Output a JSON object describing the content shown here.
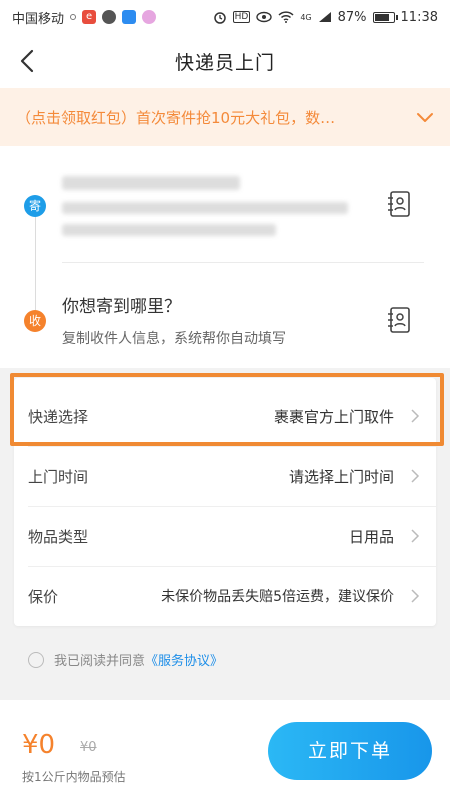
{
  "status_bar": {
    "carrier": "中国移动",
    "battery_percent": "87%",
    "time": "11:38",
    "hd_badge": "HD",
    "network": "4G",
    "battery_level": 0.87
  },
  "nav": {
    "title": "快递员上门"
  },
  "promo": {
    "text": "（点击领取红包）首次寄件抢10元大礼包，数…"
  },
  "address": {
    "sender_tag": "寄",
    "receiver_tag": "收",
    "receiver_title": "你想寄到哪里？",
    "receiver_hint": "复制收件人信息，系统帮你自动填写"
  },
  "options": [
    {
      "label": "快递选择",
      "value": "裹裹官方上门取件"
    },
    {
      "label": "上门时间",
      "value": "请选择上门时间"
    },
    {
      "label": "物品类型",
      "value": "日用品"
    },
    {
      "label": "保价",
      "value": "未保价物品丢失赔5倍运费，建议保价"
    }
  ],
  "agreement": {
    "prefix": "我已阅读并同意",
    "link": "《服务协议》"
  },
  "footer": {
    "price": "¥0",
    "original_price": "¥0",
    "estimate_note": "按1公斤内物品预估",
    "submit_label": "立即下单"
  },
  "colors": {
    "accent_blue": "#1e9de8",
    "accent_orange": "#f5822c",
    "promo_bg": "#fef1e6",
    "highlight_border": "#f08a33"
  }
}
